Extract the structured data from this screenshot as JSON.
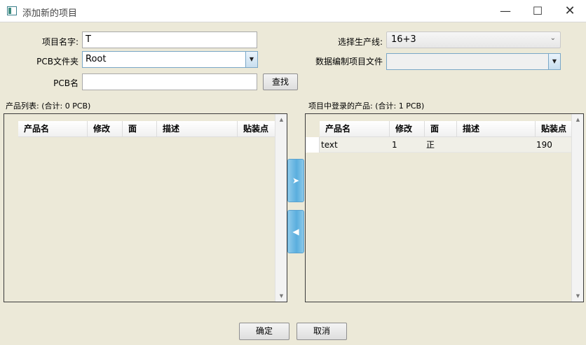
{
  "window": {
    "title": "添加新的项目",
    "minimize": "—",
    "maximize": "☐",
    "close": "✕"
  },
  "form": {
    "project_name_label": "项目名字:",
    "project_name_value": "T",
    "pcb_folder_label": "PCB文件夹",
    "pcb_folder_value": "Root",
    "pcb_name_label": "PCB名",
    "pcb_name_value": "",
    "search_button": "查找",
    "line_label": "选择生产线:",
    "line_value": "16+3",
    "data_folder_label": "数据编制项目文件夹",
    "data_folder_value": ""
  },
  "product_list": {
    "label": "产品列表: (合计: 0 PCB)",
    "columns": [
      "产品名",
      "修改",
      "面",
      "描述",
      "贴装点"
    ],
    "rows": []
  },
  "project_products": {
    "label": "项目中登录的产品: (合计: 1 PCB)",
    "columns": [
      "产品名",
      "修改",
      "面",
      "描述",
      "贴装点"
    ],
    "rows": [
      {
        "name": "text",
        "revision": "1",
        "side": "正",
        "description": "",
        "points": "190"
      }
    ]
  },
  "transfer": {
    "add_arrow": "➤",
    "remove_arrow": "◀"
  },
  "footer": {
    "ok": "确定",
    "cancel": "取消"
  },
  "icons": {
    "dropdown": "▼",
    "chevron": "⌄",
    "scroll_up": "▲",
    "scroll_down": "▼"
  }
}
